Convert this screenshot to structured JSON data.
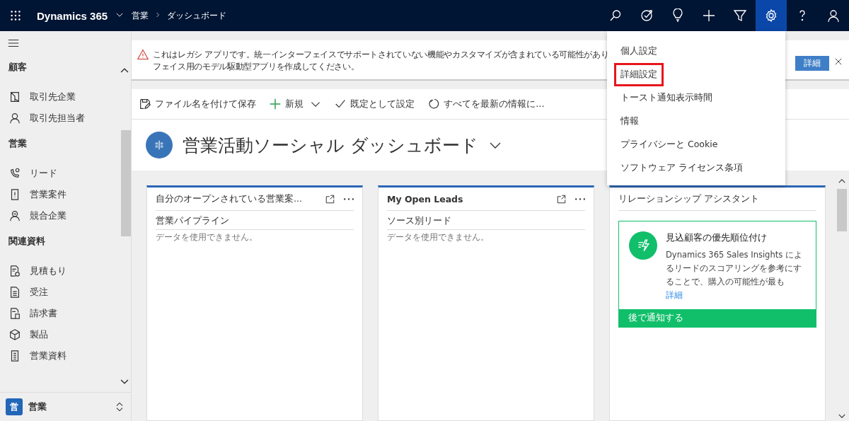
{
  "topbar": {
    "app_name": "Dynamics 365",
    "breadcrumb": [
      "営業",
      "ダッシュボード"
    ],
    "actions": [
      {
        "kind": "search",
        "selected": false
      },
      {
        "kind": "goal",
        "selected": false
      },
      {
        "kind": "idea",
        "selected": false
      },
      {
        "kind": "add",
        "selected": false
      },
      {
        "kind": "filter",
        "selected": false
      },
      {
        "kind": "settings",
        "selected": true
      },
      {
        "kind": "help",
        "selected": false
      },
      {
        "kind": "user",
        "selected": false
      }
    ]
  },
  "sidebar": {
    "groups": [
      {
        "title": "顧客",
        "items": [
          {
            "kind": "account",
            "label": "取引先企業"
          },
          {
            "kind": "contact",
            "label": "取引先担当者"
          }
        ]
      },
      {
        "title": "営業",
        "items": [
          {
            "kind": "lead",
            "label": "リード"
          },
          {
            "kind": "opportunity",
            "label": "営業案件"
          },
          {
            "kind": "competitor",
            "label": "競合企業"
          }
        ]
      },
      {
        "title": "関連資料",
        "items": [
          {
            "kind": "quote",
            "label": "見積もり"
          },
          {
            "kind": "order",
            "label": "受注"
          },
          {
            "kind": "invoice",
            "label": "請求書"
          },
          {
            "kind": "product",
            "label": "製品"
          },
          {
            "kind": "collateral",
            "label": "営業資料"
          }
        ]
      }
    ],
    "area": {
      "badge": "営",
      "label": "営業"
    }
  },
  "notice": {
    "lines": [
      "これはレガシ アプリです。統一インターフェイスでサポートされていない機能やカスタマイズが含まれている可能性があり",
      "フェイス用のモデル駆動型アプリを作成してください。"
    ],
    "button": "詳細"
  },
  "commands": [
    {
      "kind": "save",
      "label": "ファイル名を付けて保存"
    },
    {
      "kind": "new",
      "label": "新規"
    },
    {
      "kind": "default",
      "label": "既定として設定"
    },
    {
      "kind": "refresh",
      "label": "すべてを最新の情報に..."
    }
  ],
  "dashboard": {
    "title": "営業活動ソーシャル ダッシュボード"
  },
  "cards": [
    {
      "kind": "chart",
      "title": "自分のオープンされている営業案...",
      "subtitle": "営業パイプライン",
      "message": "データを使用できません。"
    },
    {
      "kind": "chart",
      "title": "My Open Leads",
      "subtitle": "ソース別リード",
      "message": "データを使用できません。"
    },
    {
      "kind": "assistant",
      "title": "リレーションシップ アシスタント",
      "tile": {
        "heading": "見込顧客の優先順位付け",
        "body": "Dynamics 365 Sales Insights によるリードのスコアリングを参考にすることで、購入の可能性が最も",
        "link": "詳細",
        "action": "後で通知する"
      }
    }
  ],
  "settings_menu": {
    "items": [
      {
        "label": "個人設定",
        "highlighted": false
      },
      {
        "label": "詳細設定",
        "highlighted": true
      },
      {
        "label": "トースト通知表示時間",
        "highlighted": false
      },
      {
        "label": "情報",
        "highlighted": false
      },
      {
        "label": "プライバシーと Cookie",
        "highlighted": false
      },
      {
        "label": "ソフトウェア ライセンス条項",
        "highlighted": false
      }
    ]
  }
}
